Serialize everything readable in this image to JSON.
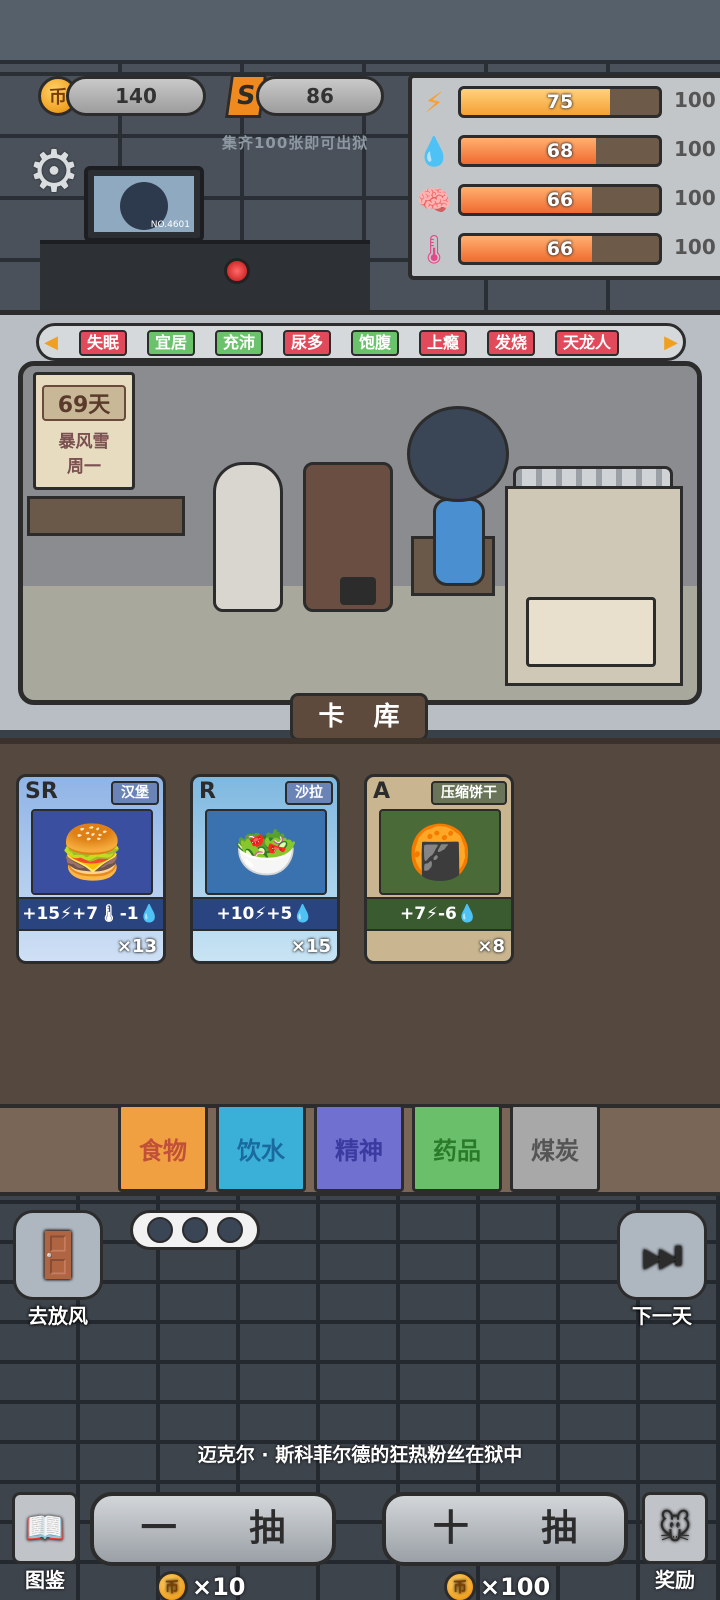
{
  "currencies": {
    "coins": "140",
    "coin_symbol": "币",
    "s_tokens": "86",
    "s_symbol": "S",
    "hint": "集齐100张即可出狱"
  },
  "monitor": {
    "id": "NO.4601"
  },
  "stats": [
    {
      "icon": "energy-icon",
      "value": "75",
      "max": "100",
      "level": 0.75,
      "color": "#f5a035"
    },
    {
      "icon": "water-icon",
      "value": "68",
      "max": "100",
      "level": 0.68,
      "color": "#f06a30"
    },
    {
      "icon": "brain-icon",
      "value": "66",
      "max": "100",
      "level": 0.66,
      "color": "#f06a30"
    },
    {
      "icon": "thermometer-icon",
      "value": "66",
      "max": "100",
      "level": 0.66,
      "color": "#f06a30"
    }
  ],
  "tags": [
    {
      "label": "失眠",
      "color": "red"
    },
    {
      "label": "宜居",
      "color": "green"
    },
    {
      "label": "充沛",
      "color": "green"
    },
    {
      "label": "尿多",
      "color": "red"
    },
    {
      "label": "饱腹",
      "color": "green"
    },
    {
      "label": "上瘾",
      "color": "red"
    },
    {
      "label": "发烧",
      "color": "red"
    },
    {
      "label": "天龙人",
      "color": "red"
    }
  ],
  "calendar": {
    "day": "69天",
    "weather": "暴风雪",
    "weekday": "周一"
  },
  "card_library_label": "卡 库",
  "cards": [
    {
      "rarity": "SR",
      "name": "汉堡",
      "effect": "+15⚡+7🌡-1💧",
      "count": "×13",
      "icon": "burger-icon"
    },
    {
      "rarity": "R",
      "name": "沙拉",
      "effect": "+10⚡+5💧",
      "count": "×15",
      "icon": "salad-icon"
    },
    {
      "rarity": "A",
      "name": "压缩饼干",
      "effect": "+7⚡-6💧",
      "count": "×8",
      "icon": "biscuit-icon"
    }
  ],
  "categories": [
    "食物",
    "饮水",
    "精神",
    "药品",
    "煤炭"
  ],
  "bottom": {
    "release_label": "去放风",
    "next_day_label": "下一天",
    "status_message": "迈克尔 · 斯科菲尔德的狂热粉丝在狱中",
    "single_draw": "一 抽",
    "single_cost": "×10",
    "ten_draw": "十 抽",
    "ten_cost": "×100",
    "codex_label": "图鉴",
    "reward_label": "奖励"
  }
}
